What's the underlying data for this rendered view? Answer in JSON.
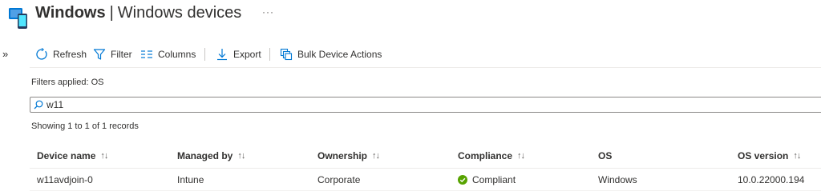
{
  "header": {
    "title_strong": "Windows",
    "title_sep": "|",
    "title_rest": "Windows devices",
    "more": "···"
  },
  "nav": {
    "expand": "»"
  },
  "toolbar": {
    "refresh": "Refresh",
    "filter": "Filter",
    "columns": "Columns",
    "export": "Export",
    "bulk_actions": "Bulk Device Actions"
  },
  "filters_applied": "Filters applied: OS",
  "search": {
    "value": "w11"
  },
  "records_text": "Showing 1 to 1 of 1 records",
  "table": {
    "columns": [
      "Device name",
      "Managed by",
      "Ownership",
      "Compliance",
      "OS",
      "OS version"
    ],
    "sort_glyph": "↑↓",
    "rows": [
      {
        "device_name": "w11avdjoin-0",
        "managed_by": "Intune",
        "ownership": "Corporate",
        "compliance": "Compliant",
        "os": "Windows",
        "os_version": "10.0.22000.194"
      }
    ]
  },
  "colors": {
    "accent": "#0078d4",
    "compliant": "#57a300",
    "text": "#323130"
  }
}
